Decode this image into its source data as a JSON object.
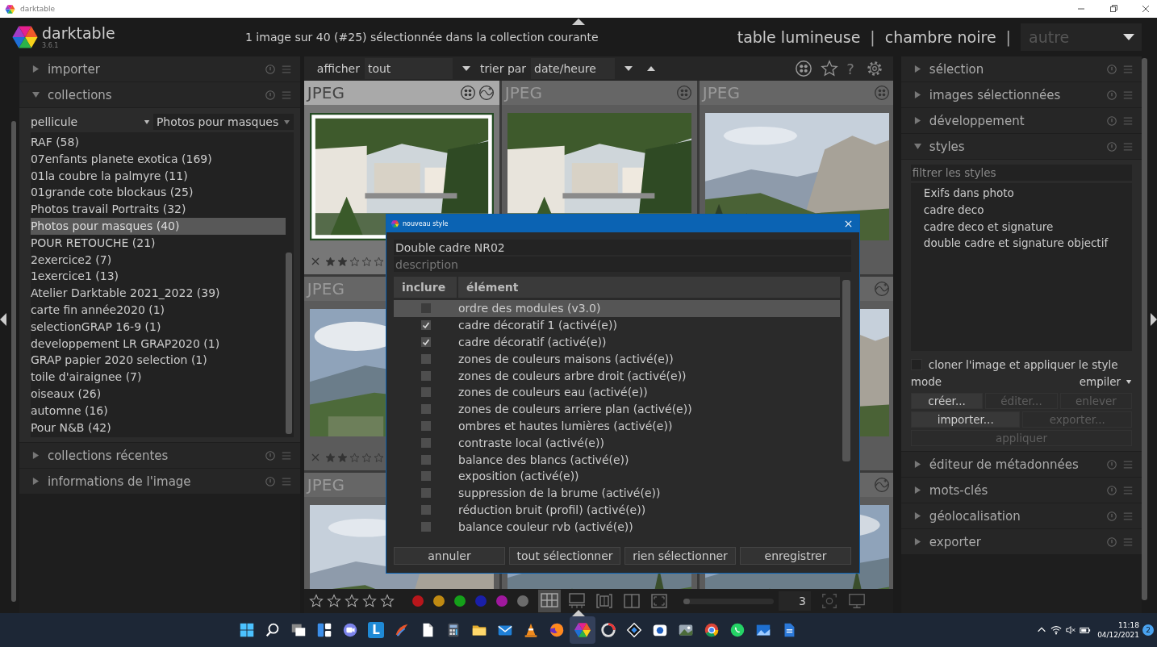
{
  "os_window": {
    "title": "darktable"
  },
  "header": {
    "app_name": "darktable",
    "version": "3.6.1",
    "status": "1 image sur 40 (#25) sélectionnée dans la collection courante",
    "separator": "|",
    "views": [
      {
        "label": "table lumineuse",
        "kind": "view"
      },
      {
        "label": "chambre noire",
        "kind": "view"
      },
      {
        "label": "autre",
        "kind": "menu"
      }
    ]
  },
  "left_panel": {
    "modules": [
      {
        "title": "importer",
        "expanded": false,
        "kind": "basic"
      },
      {
        "title": "collections",
        "expanded": true,
        "kind": "collections"
      },
      {
        "title": "collections récentes",
        "expanded": false,
        "kind": "basic"
      },
      {
        "title": "informations de l'image",
        "expanded": false,
        "kind": "basic"
      }
    ],
    "collections": {
      "property": "pellicule",
      "value": "Photos pour masques",
      "items": [
        {
          "label": "RAF (58)",
          "selected": false
        },
        {
          "label": "07enfants planete exotica (169)",
          "selected": false
        },
        {
          "label": "01la coubre la palmyre (11)",
          "selected": false
        },
        {
          "label": "01grande cote blockaus (25)",
          "selected": false
        },
        {
          "label": "Photos travail Portraits (32)",
          "selected": false
        },
        {
          "label": "Photos pour masques (40)",
          "selected": true
        },
        {
          "label": "POUR RETOUCHE (21)",
          "selected": false
        },
        {
          "label": "2exercice2 (7)",
          "selected": false
        },
        {
          "label": "1exercice1 (13)",
          "selected": false
        },
        {
          "label": "Atelier Darktable 2021_2022 (39)",
          "selected": false
        },
        {
          "label": "carte fin année2020 (1)",
          "selected": false
        },
        {
          "label": "selectionGRAP 16-9 (1)",
          "selected": false
        },
        {
          "label": "developpement  LR GRAP2020 (1)",
          "selected": false
        },
        {
          "label": "GRAP papier 2020 selection (1)",
          "selected": false
        },
        {
          "label": "toile d'airaignee (7)",
          "selected": false
        },
        {
          "label": "oiseaux (26)",
          "selected": false
        },
        {
          "label": "automne (16)",
          "selected": false
        },
        {
          "label": "Pour N&B (42)",
          "selected": false
        }
      ]
    }
  },
  "lighttable": {
    "toolbar": {
      "show_label": "afficher",
      "show_value": "tout",
      "sort_label": "trier par",
      "sort_value": "date/heure",
      "help": "?"
    },
    "thumbs": [
      {
        "label": "JPEG",
        "selected": true,
        "grouped": true,
        "altered": true,
        "stars": 2
      },
      {
        "label": "JPEG",
        "selected": false,
        "grouped": true
      },
      {
        "label": "JPEG",
        "selected": false,
        "grouped": true
      },
      {
        "label": "JPEG",
        "selected": false,
        "stars": 2
      },
      {
        "selected": false,
        "altered": true
      },
      {
        "label": "JPEG",
        "selected": false
      },
      {
        "selected": false
      },
      {
        "selected": false,
        "altered": true
      }
    ],
    "bottom_bar": {
      "stars": 0,
      "color_labels": [
        {
          "color": "#b8161b"
        },
        {
          "color": "#c08a12"
        },
        {
          "color": "#15a01a"
        },
        {
          "color": "#1a1fa8"
        },
        {
          "color": "#a0189e"
        },
        {
          "color": "#6b6b6b"
        }
      ],
      "layouts": [
        {
          "kind": "grid",
          "selected": true
        },
        {
          "kind": "strip",
          "selected": false
        },
        {
          "kind": "compare",
          "selected": false
        },
        {
          "kind": "split",
          "selected": false
        },
        {
          "kind": "fullscreen",
          "selected": false
        }
      ],
      "zoom": {
        "level": 0.06,
        "reading": "3"
      }
    }
  },
  "dialog": {
    "title": "nouveau style",
    "name": "Double cadre NR02",
    "description_placeholder": "description",
    "columns": [
      "inclure",
      "élément"
    ],
    "rows": [
      {
        "label": "ordre des modules (v3.0)",
        "checked": false,
        "selected": true
      },
      {
        "label": "cadre décoratif 1 (activé(e))",
        "checked": true,
        "selected": false
      },
      {
        "label": "cadre décoratif  (activé(e))",
        "checked": true,
        "selected": false
      },
      {
        "label": "zones de couleurs maisons (activé(e))",
        "checked": false,
        "selected": false
      },
      {
        "label": "zones de couleurs arbre droit (activé(e))",
        "checked": false,
        "selected": false
      },
      {
        "label": "zones de couleurs eau (activé(e))",
        "checked": false,
        "selected": false
      },
      {
        "label": "zones de couleurs arriere plan (activé(e))",
        "checked": false,
        "selected": false
      },
      {
        "label": "ombres et hautes lumières  (activé(e))",
        "checked": false,
        "selected": false
      },
      {
        "label": "contraste local  (activé(e))",
        "checked": false,
        "selected": false
      },
      {
        "label": "balance des blancs  (activé(e))",
        "checked": false,
        "selected": false
      },
      {
        "label": "exposition  (activé(e))",
        "checked": false,
        "selected": false
      },
      {
        "label": "suppression de la brume  (activé(e))",
        "checked": false,
        "selected": false
      },
      {
        "label": "réduction bruit (profil)  (activé(e))",
        "checked": false,
        "selected": false
      },
      {
        "label": "balance couleur rvb  (activé(e))",
        "checked": false,
        "selected": false
      }
    ],
    "buttons": [
      "annuler",
      "tout sélectionner",
      "rien sélectionner",
      "enregistrer"
    ]
  },
  "right_panel": {
    "modules": [
      {
        "title": "sélection",
        "expanded": false,
        "kind": "basic"
      },
      {
        "title": "images sélectionnées",
        "expanded": false,
        "kind": "basic"
      },
      {
        "title": "développement",
        "expanded": false,
        "kind": "basic"
      },
      {
        "title": "styles",
        "expanded": true,
        "kind": "styles"
      },
      {
        "title": "éditeur de métadonnées",
        "expanded": false,
        "kind": "basic"
      },
      {
        "title": "mots-clés",
        "expanded": false,
        "kind": "basic"
      },
      {
        "title": "géolocalisation",
        "expanded": false,
        "kind": "basic"
      },
      {
        "title": "exporter",
        "expanded": false,
        "kind": "basic"
      }
    ],
    "styles": {
      "filter_placeholder": "filtrer les styles",
      "items": [
        "Exifs dans photo",
        "cadre deco",
        "cadre deco et signature",
        "double cadre et signature objectif"
      ],
      "clone": {
        "label": "cloner l'image et appliquer le style",
        "checked": false
      },
      "mode_label": "mode",
      "mode_value": "empiler",
      "buttons": [
        {
          "label": "créer...",
          "disabled": false
        },
        {
          "label": "éditer...",
          "disabled": true
        },
        {
          "label": "enlever",
          "disabled": true
        },
        {
          "label": "importer...",
          "disabled": false
        },
        {
          "label": "exporter...",
          "disabled": true
        },
        {
          "label": "appliquer",
          "disabled": true
        }
      ]
    }
  },
  "taskbar": {
    "apps": [
      {
        "kind": "windows",
        "selected": false
      },
      {
        "kind": "search",
        "selected": false
      },
      {
        "kind": "taskview",
        "selected": false
      },
      {
        "kind": "widgets",
        "selected": false
      },
      {
        "kind": "chat",
        "selected": false
      },
      {
        "kind": "letter",
        "label": "L",
        "selected": false
      },
      {
        "kind": "brush",
        "selected": false
      },
      {
        "kind": "document",
        "selected": false
      },
      {
        "kind": "calculator",
        "selected": false
      },
      {
        "kind": "folder",
        "selected": false
      },
      {
        "kind": "mail",
        "selected": false
      },
      {
        "kind": "cone",
        "selected": false
      },
      {
        "kind": "fox",
        "selected": false
      },
      {
        "kind": "aperture",
        "selected": true
      },
      {
        "kind": "ring",
        "selected": false
      },
      {
        "kind": "diamond",
        "selected": false
      },
      {
        "kind": "camera",
        "selected": false
      },
      {
        "kind": "photos",
        "selected": false
      },
      {
        "kind": "chrome",
        "selected": false
      },
      {
        "kind": "whatsapp",
        "selected": false
      },
      {
        "kind": "viewer",
        "selected": false
      },
      {
        "kind": "doc",
        "selected": false
      }
    ],
    "tray": {
      "time": "11:18",
      "date": "04/12/2021",
      "badge": "2"
    }
  }
}
